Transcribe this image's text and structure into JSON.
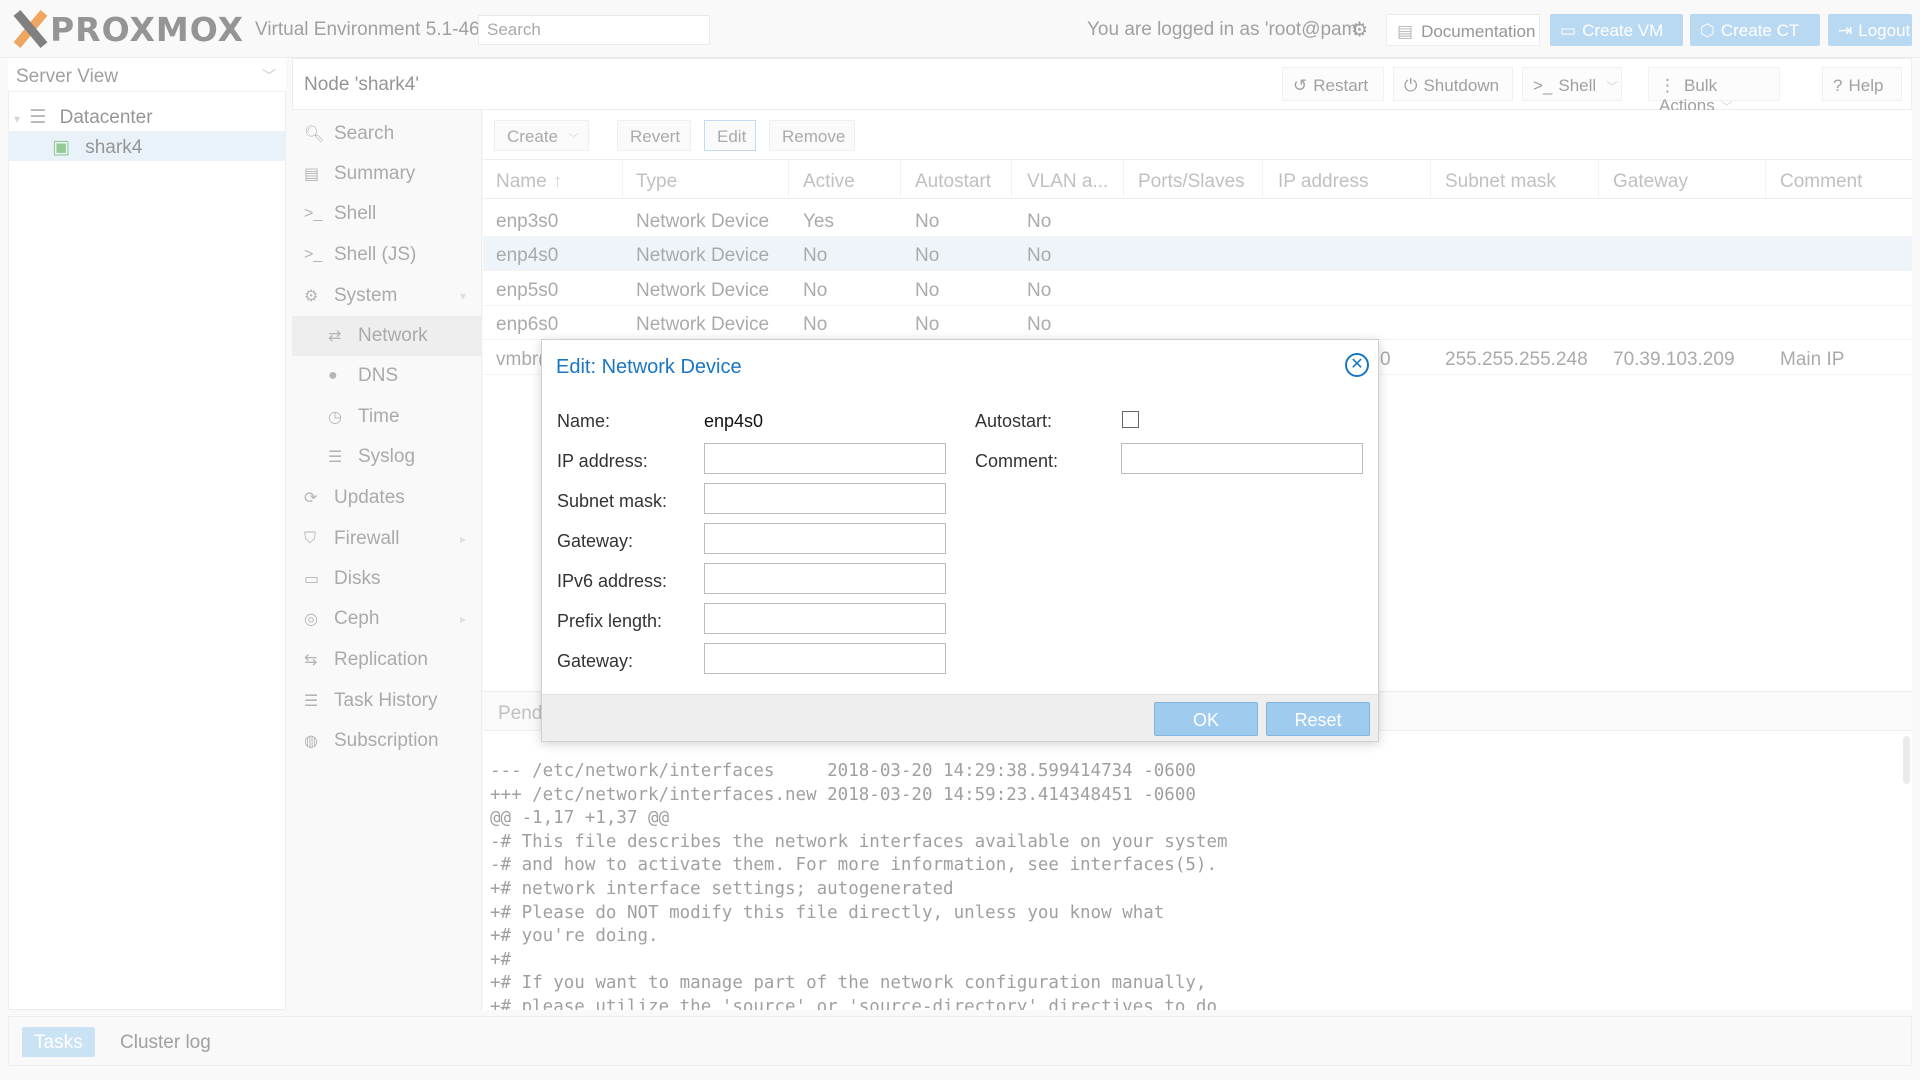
{
  "header": {
    "logo_text": "PROXMOX",
    "version": "Virtual Environment 5.1-46",
    "search_placeholder": "Search",
    "logged_in": "You are logged in as 'root@pam'",
    "documentation": "Documentation",
    "create_vm": "Create VM",
    "create_ct": "Create CT",
    "logout": "Logout"
  },
  "tree": {
    "view": "Server View",
    "datacenter": "Datacenter",
    "node": "shark4"
  },
  "node_bar": {
    "title": "Node 'shark4'",
    "restart": "Restart",
    "shutdown": "Shutdown",
    "shell": "Shell",
    "bulk_actions": "Bulk Actions",
    "help": "Help"
  },
  "nav": {
    "search": "Search",
    "summary": "Summary",
    "shell": "Shell",
    "shell_js": "Shell (JS)",
    "system": "System",
    "network": "Network",
    "dns": "DNS",
    "time": "Time",
    "syslog": "Syslog",
    "updates": "Updates",
    "firewall": "Firewall",
    "disks": "Disks",
    "ceph": "Ceph",
    "replication": "Replication",
    "task_history": "Task History",
    "subscription": "Subscription"
  },
  "network_toolbar": {
    "create": "Create",
    "revert": "Revert",
    "edit": "Edit",
    "remove": "Remove"
  },
  "grid": {
    "columns": [
      "Name",
      "Type",
      "Active",
      "Autostart",
      "VLAN a...",
      "Ports/Slaves",
      "IP address",
      "Subnet mask",
      "Gateway",
      "Comment"
    ],
    "rows": [
      {
        "name": "enp3s0",
        "type": "Network Device",
        "active": "Yes",
        "autostart": "No",
        "vlan": "No"
      },
      {
        "name": "enp4s0",
        "type": "Network Device",
        "active": "No",
        "autostart": "No",
        "vlan": "No"
      },
      {
        "name": "enp5s0",
        "type": "Network Device",
        "active": "No",
        "autostart": "No",
        "vlan": "No"
      },
      {
        "name": "enp6s0",
        "type": "Network Device",
        "active": "No",
        "autostart": "No",
        "vlan": "No"
      }
    ],
    "row5": {
      "name": "vmbr(",
      "ip_fragment": "0",
      "subnet": "255.255.255.248",
      "gateway": "70.39.103.209",
      "comment": "Main IP"
    }
  },
  "pending": {
    "label": "Pend",
    "diff_lines": [
      "--- /etc/network/interfaces     2018-03-20 14:29:38.599414734 -0600",
      "+++ /etc/network/interfaces.new 2018-03-20 14:59:23.414348451 -0600",
      "@@ -1,17 +1,37 @@",
      "-# This file describes the network interfaces available on your system",
      "-# and how to activate them. For more information, see interfaces(5).",
      "+# network interface settings; autogenerated",
      "+# Please do NOT modify this file directly, unless you know what",
      "+# you're doing.",
      "+#",
      "+# If you want to manage part of the network configuration manually,",
      "+# please utilize the 'source' or 'source-directory' directives to do"
    ]
  },
  "bottom": {
    "tasks": "Tasks",
    "cluster_log": "Cluster log"
  },
  "dialog": {
    "title": "Edit: Network Device",
    "name_label": "Name:",
    "name_value": "enp4s0",
    "autostart_label": "Autostart:",
    "autostart_checked": false,
    "ip_label": "IP address:",
    "comment_label": "Comment:",
    "subnet_label": "Subnet mask:",
    "gateway_label": "Gateway:",
    "ipv6_label": "IPv6 address:",
    "prefix_label": "Prefix length:",
    "gateway6_label": "Gateway:",
    "ok": "OK",
    "reset": "Reset"
  }
}
